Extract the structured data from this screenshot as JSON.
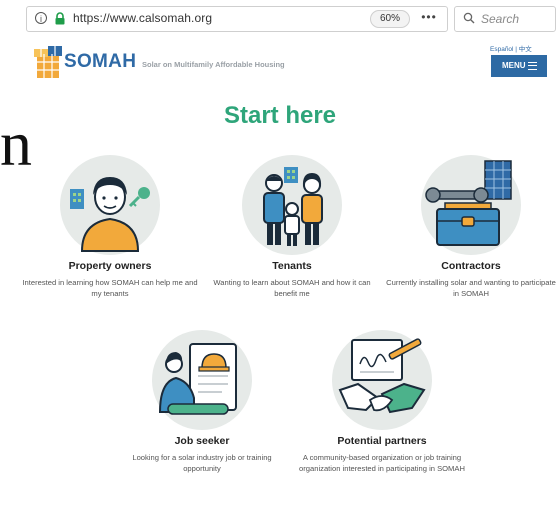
{
  "page_edge_glyph": "n",
  "browser": {
    "url": "https://www.calsomah.org",
    "zoom": "60%",
    "more": "•••",
    "search_placeholder": "Search"
  },
  "header": {
    "brand": "SOMAH",
    "tagline": "Solar on Multifamily Affordable Housing",
    "languages": "Español | 中文",
    "menu_label": "MENU"
  },
  "main": {
    "heading": "Start here",
    "cards": [
      {
        "title": "Property owners",
        "description": "Interested in learning how SOMAH can help me and my tenants"
      },
      {
        "title": "Tenants",
        "description": "Wanting to learn about SOMAH and how it can benefit me"
      },
      {
        "title": "Contractors",
        "description": "Currently installing solar and wanting to participate in SOMAH"
      },
      {
        "title": "Job seeker",
        "description": "Looking for a solar industry job or training opportunity"
      },
      {
        "title": "Potential partners",
        "description": "A community-based organization or job training organization interested in participating in SOMAH"
      }
    ]
  },
  "colors": {
    "accent_green": "#2ea57a",
    "brand_blue": "#2f6aa6",
    "circle_bg": "#e6eae8"
  }
}
